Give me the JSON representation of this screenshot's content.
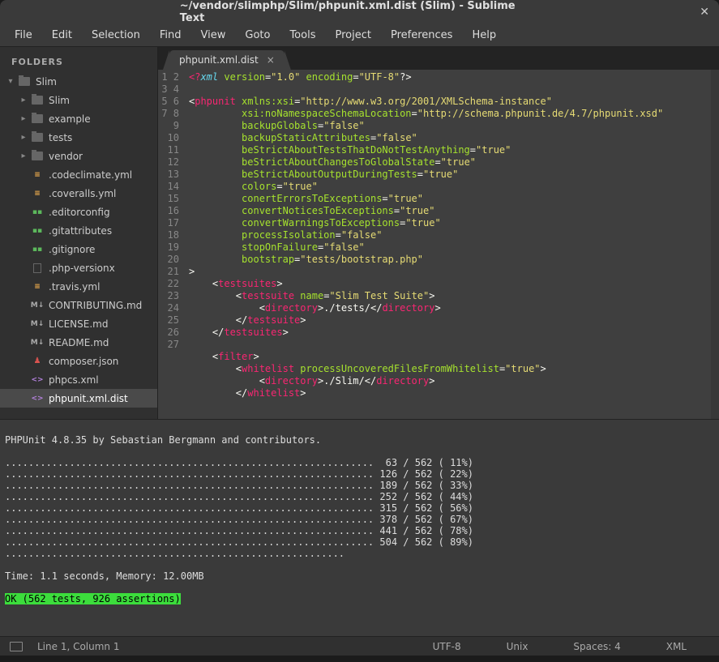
{
  "title": "~/vendor/slimphp/Slim/phpunit.xml.dist (Slim) - Sublime Text",
  "menubar": [
    "File",
    "Edit",
    "Selection",
    "Find",
    "View",
    "Goto",
    "Tools",
    "Project",
    "Preferences",
    "Help"
  ],
  "sidebar": {
    "header": "FOLDERS",
    "root": {
      "label": "Slim",
      "arrow": "▾"
    },
    "folders": [
      {
        "label": "Slim",
        "arrow": "▸"
      },
      {
        "label": "example",
        "arrow": "▸"
      },
      {
        "label": "tests",
        "arrow": "▸"
      },
      {
        "label": "vendor",
        "arrow": "▸"
      }
    ],
    "files": [
      {
        "label": ".codeclimate.yml",
        "icon": "yml"
      },
      {
        "label": ".coveralls.yml",
        "icon": "yml"
      },
      {
        "label": ".editorconfig",
        "icon": "green"
      },
      {
        "label": ".gitattributes",
        "icon": "green"
      },
      {
        "label": ".gitignore",
        "icon": "green"
      },
      {
        "label": ".php-versionx",
        "icon": "plain"
      },
      {
        "label": ".travis.yml",
        "icon": "yml"
      },
      {
        "label": "CONTRIBUTING.md",
        "icon": "md"
      },
      {
        "label": "LICENSE.md",
        "icon": "md"
      },
      {
        "label": "README.md",
        "icon": "md"
      },
      {
        "label": "composer.json",
        "icon": "composer"
      },
      {
        "label": "phpcs.xml",
        "icon": "xml"
      },
      {
        "label": "phpunit.xml.dist",
        "icon": "xml",
        "selected": true
      }
    ]
  },
  "tabs": [
    {
      "label": "phpunit.xml.dist",
      "active": true
    }
  ],
  "code_lines": 27,
  "code_tokens": [
    [
      {
        "t": "<?",
        "c": "decl"
      },
      {
        "t": "xml",
        "c": "xml"
      },
      {
        "t": " version",
        "c": "attr"
      },
      {
        "t": "=",
        "c": "op"
      },
      {
        "t": "\"1.0\"",
        "c": "str"
      },
      {
        "t": " encoding",
        "c": "attr"
      },
      {
        "t": "=",
        "c": "op"
      },
      {
        "t": "\"UTF-8\"",
        "c": "str"
      },
      {
        "t": "?>",
        "c": "op"
      }
    ],
    [],
    [
      {
        "t": "<",
        "c": "op"
      },
      {
        "t": "phpunit",
        "c": "tag"
      },
      {
        "t": " xmlns:xsi",
        "c": "attr"
      },
      {
        "t": "=",
        "c": "op"
      },
      {
        "t": "\"http://www.w3.org/2001/XMLSchema-instance\"",
        "c": "str"
      }
    ],
    [
      {
        "t": "         xsi:noNamespaceSchemaLocation",
        "c": "attr"
      },
      {
        "t": "=",
        "c": "op"
      },
      {
        "t": "\"http://schema.phpunit.de/4.7/phpunit.xsd\"",
        "c": "str"
      }
    ],
    [
      {
        "t": "         backupGlobals",
        "c": "attr"
      },
      {
        "t": "=",
        "c": "op"
      },
      {
        "t": "\"false\"",
        "c": "str"
      }
    ],
    [
      {
        "t": "         backupStaticAttributes",
        "c": "attr"
      },
      {
        "t": "=",
        "c": "op"
      },
      {
        "t": "\"false\"",
        "c": "str"
      }
    ],
    [
      {
        "t": "         beStrictAboutTestsThatDoNotTestAnything",
        "c": "attr"
      },
      {
        "t": "=",
        "c": "op"
      },
      {
        "t": "\"true\"",
        "c": "str"
      }
    ],
    [
      {
        "t": "         beStrictAboutChangesToGlobalState",
        "c": "attr"
      },
      {
        "t": "=",
        "c": "op"
      },
      {
        "t": "\"true\"",
        "c": "str"
      }
    ],
    [
      {
        "t": "         beStrictAboutOutputDuringTests",
        "c": "attr"
      },
      {
        "t": "=",
        "c": "op"
      },
      {
        "t": "\"true\"",
        "c": "str"
      }
    ],
    [
      {
        "t": "         colors",
        "c": "attr"
      },
      {
        "t": "=",
        "c": "op"
      },
      {
        "t": "\"true\"",
        "c": "str"
      }
    ],
    [
      {
        "t": "         conertErrorsToExceptions",
        "c": "attr"
      },
      {
        "t": "=",
        "c": "op"
      },
      {
        "t": "\"true\"",
        "c": "str"
      }
    ],
    [
      {
        "t": "         convertNoticesToExceptions",
        "c": "attr"
      },
      {
        "t": "=",
        "c": "op"
      },
      {
        "t": "\"true\"",
        "c": "str"
      }
    ],
    [
      {
        "t": "         convertWarningsToExceptions",
        "c": "attr"
      },
      {
        "t": "=",
        "c": "op"
      },
      {
        "t": "\"true\"",
        "c": "str"
      }
    ],
    [
      {
        "t": "         processIsolation",
        "c": "attr"
      },
      {
        "t": "=",
        "c": "op"
      },
      {
        "t": "\"false\"",
        "c": "str"
      }
    ],
    [
      {
        "t": "         stopOnFailure",
        "c": "attr"
      },
      {
        "t": "=",
        "c": "op"
      },
      {
        "t": "\"false\"",
        "c": "str"
      }
    ],
    [
      {
        "t": "         bootstrap",
        "c": "attr"
      },
      {
        "t": "=",
        "c": "op"
      },
      {
        "t": "\"tests/bootstrap.php\"",
        "c": "str"
      }
    ],
    [
      {
        "t": ">",
        "c": "op"
      }
    ],
    [
      {
        "t": "    <",
        "c": "op"
      },
      {
        "t": "testsuites",
        "c": "tag"
      },
      {
        "t": ">",
        "c": "op"
      }
    ],
    [
      {
        "t": "        <",
        "c": "op"
      },
      {
        "t": "testsuite",
        "c": "tag"
      },
      {
        "t": " name",
        "c": "attr"
      },
      {
        "t": "=",
        "c": "op"
      },
      {
        "t": "\"Slim Test Suite\"",
        "c": "str"
      },
      {
        "t": ">",
        "c": "op"
      }
    ],
    [
      {
        "t": "            <",
        "c": "op"
      },
      {
        "t": "directory",
        "c": "tag"
      },
      {
        "t": ">./tests/</",
        "c": "op"
      },
      {
        "t": "directory",
        "c": "tag"
      },
      {
        "t": ">",
        "c": "op"
      }
    ],
    [
      {
        "t": "        </",
        "c": "op"
      },
      {
        "t": "testsuite",
        "c": "tag"
      },
      {
        "t": ">",
        "c": "op"
      }
    ],
    [
      {
        "t": "    </",
        "c": "op"
      },
      {
        "t": "testsuites",
        "c": "tag"
      },
      {
        "t": ">",
        "c": "op"
      }
    ],
    [],
    [
      {
        "t": "    <",
        "c": "op"
      },
      {
        "t": "filter",
        "c": "tag"
      },
      {
        "t": ">",
        "c": "op"
      }
    ],
    [
      {
        "t": "        <",
        "c": "op"
      },
      {
        "t": "whitelist",
        "c": "tag"
      },
      {
        "t": " processUncoveredFilesFromWhitelist",
        "c": "attr"
      },
      {
        "t": "=",
        "c": "op"
      },
      {
        "t": "\"true\"",
        "c": "str"
      },
      {
        "t": ">",
        "c": "op"
      }
    ],
    [
      {
        "t": "            <",
        "c": "op"
      },
      {
        "t": "directory",
        "c": "tag"
      },
      {
        "t": ">./Slim/</",
        "c": "op"
      },
      {
        "t": "directory",
        "c": "tag"
      },
      {
        "t": ">",
        "c": "op"
      }
    ],
    [
      {
        "t": "        </",
        "c": "op"
      },
      {
        "t": "whitelist",
        "c": "tag"
      },
      {
        "t": ">",
        "c": "op"
      }
    ]
  ],
  "console": {
    "header": "PHPUnit 4.8.35 by Sebastian Bergmann and contributors.",
    "progress": [
      "...............................................................  63 / 562 ( 11%)",
      "............................................................... 126 / 562 ( 22%)",
      "............................................................... 189 / 562 ( 33%)",
      "............................................................... 252 / 562 ( 44%)",
      "............................................................... 315 / 562 ( 56%)",
      "............................................................... 378 / 562 ( 67%)",
      "............................................................... 441 / 562 ( 78%)",
      "............................................................... 504 / 562 ( 89%)",
      ".........................................................."
    ],
    "time": "Time: 1.1 seconds, Memory: 12.00MB",
    "ok": "OK (562 tests, 926 assertions)"
  },
  "status": {
    "cursor": "Line 1, Column 1",
    "encoding": "UTF-8",
    "lineending": "Unix",
    "indent": "Spaces: 4",
    "syntax": "XML"
  }
}
